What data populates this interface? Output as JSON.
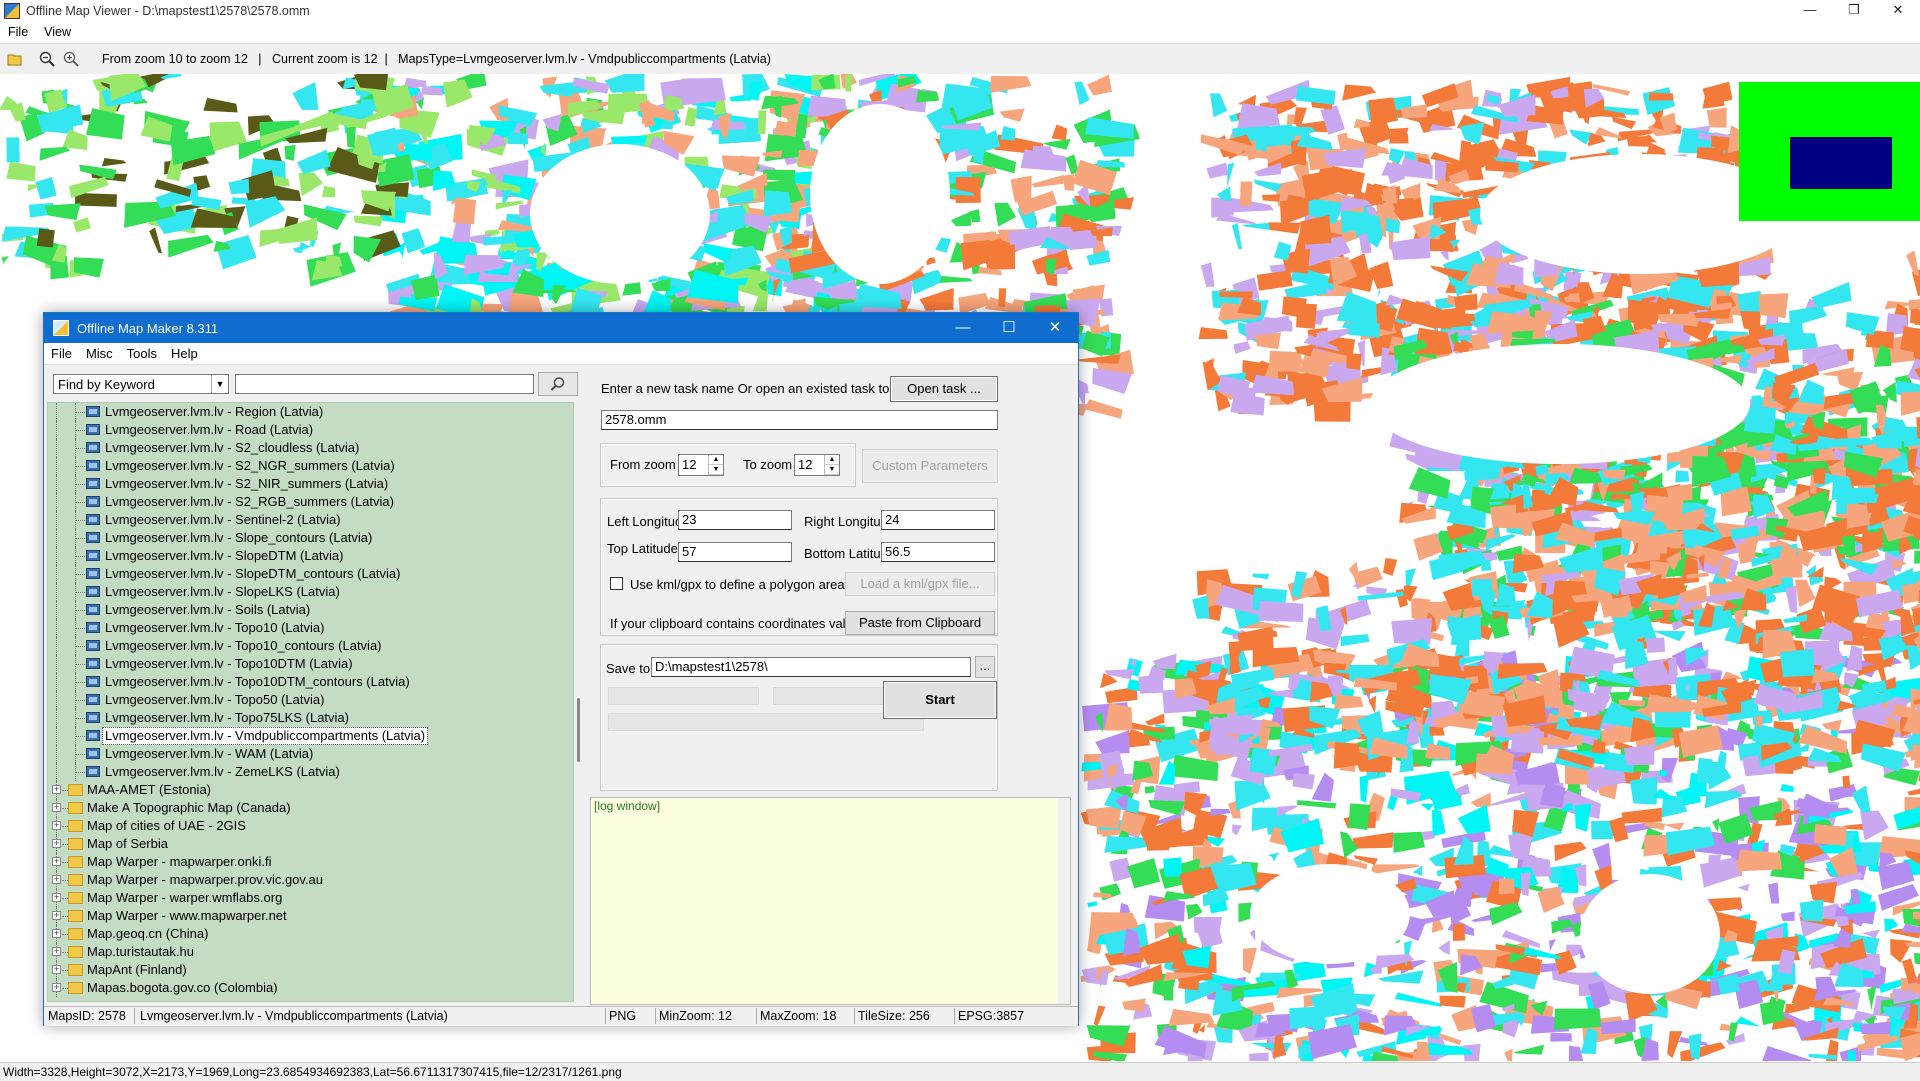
{
  "viewer": {
    "title": "Offline Map Viewer - D:\\mapstest1\\2578\\2578.omm",
    "menu": [
      "File",
      "View"
    ],
    "toolbar_info": "From zoom 10 to zoom 12   |   Current zoom is 12  |   MapsType=Lvmgeoserver.lvm.lv - Vmdpubliccompartments (Latvia)",
    "status": "Width=3328,Height=3072,X=2173,Y=1969,Long=23.6854934692383,Lat=56.6711317307415,file=12/2317/1261.png",
    "icons": [
      "open-folder-icon",
      "zoom-out-icon",
      "zoom-in-icon"
    ]
  },
  "map_colors": {
    "orange": "#f47a3a",
    "peach": "#f7a57c",
    "cyan": "#33e6f0",
    "aqua": "#00f5f5",
    "lavender": "#c9a8f0",
    "violet": "#b58cf0",
    "green": "#33dd55",
    "light_green": "#9ae86a",
    "olive": "#5a5a18",
    "minimap_bg": "#00ff00",
    "minimap_box": "#000080"
  },
  "maker": {
    "title": "Offline Map Maker 8.311",
    "menu": [
      "File",
      "Misc",
      "Tools",
      "Help"
    ],
    "search": {
      "mode": "Find by Keyword",
      "value": ""
    },
    "tree": {
      "children": [
        "Lvmgeoserver.lvm.lv - Region (Latvia)",
        "Lvmgeoserver.lvm.lv - Road (Latvia)",
        "Lvmgeoserver.lvm.lv - S2_cloudless (Latvia)",
        "Lvmgeoserver.lvm.lv - S2_NGR_summers (Latvia)",
        "Lvmgeoserver.lvm.lv - S2_NIR_summers (Latvia)",
        "Lvmgeoserver.lvm.lv - S2_RGB_summers (Latvia)",
        "Lvmgeoserver.lvm.lv - Sentinel-2 (Latvia)",
        "Lvmgeoserver.lvm.lv - Slope_contours (Latvia)",
        "Lvmgeoserver.lvm.lv - SlopeDTM (Latvia)",
        "Lvmgeoserver.lvm.lv - SlopeDTM_contours (Latvia)",
        "Lvmgeoserver.lvm.lv - SlopeLKS (Latvia)",
        "Lvmgeoserver.lvm.lv - Soils (Latvia)",
        "Lvmgeoserver.lvm.lv - Topo10 (Latvia)",
        "Lvmgeoserver.lvm.lv - Topo10_contours (Latvia)",
        "Lvmgeoserver.lvm.lv - Topo10DTM (Latvia)",
        "Lvmgeoserver.lvm.lv - Topo10DTM_contours (Latvia)",
        "Lvmgeoserver.lvm.lv - Topo50 (Latvia)",
        "Lvmgeoserver.lvm.lv - Topo75LKS (Latvia)",
        "Lvmgeoserver.lvm.lv - Vmdpubliccompartments (Latvia)",
        "Lvmgeoserver.lvm.lv - WAM (Latvia)",
        "Lvmgeoserver.lvm.lv - ZemeLKS (Latvia)"
      ],
      "selected_index": 18,
      "folders": [
        "MAA-AMET (Estonia)",
        "Make A Topographic Map (Canada)",
        "Map of cities of UAE - 2GIS",
        "Map of Serbia",
        "Map Warper - mapwarper.onki.fi",
        "Map Warper - mapwarper.prov.vic.gov.au",
        "Map Warper - warper.wmflabs.org",
        "Map Warper - www.mapwarper.net",
        "Map.geoq.cn (China)",
        "Map.turistautak.hu",
        "MapAnt (Finland)",
        "Mapas.bogota.gov.co (Colombia)"
      ]
    },
    "task": {
      "prompt": "Enter a new task name Or open an existed task to continue:",
      "open_button": "Open task ...",
      "name": "2578.omm"
    },
    "zoom": {
      "from_label": "From zoom",
      "from_value": "12",
      "to_label": "To zoom",
      "to_value": "12",
      "custom_button": "Custom Parameters"
    },
    "coords": {
      "left_label": "Left Longitude",
      "left_value": "23",
      "right_label": "Right Longitude",
      "right_value": "24",
      "top_label": "Top Latitude",
      "top_value": "57",
      "bottom_label": "Bottom Latitude",
      "bottom_value": "56.5"
    },
    "kml": {
      "checkbox_label": "Use kml/gpx to define a polygon area",
      "checked": false,
      "button": "Load a kml/gpx file..."
    },
    "clipboard": {
      "label": "If your clipboard contains coordinates values:",
      "button": "Paste from Clipboard"
    },
    "save": {
      "label": "Save to:",
      "path": "D:\\mapstest1\\2578\\",
      "browse": "..."
    },
    "start_button": "Start",
    "log": "[log window]",
    "status": {
      "maps_id": "MapsID: 2578",
      "maps_name": "Lvmgeoserver.lvm.lv - Vmdpubliccompartments (Latvia)",
      "format": "PNG",
      "min_zoom": "MinZoom: 12",
      "max_zoom": "MaxZoom: 18",
      "tile_size": "TileSize: 256",
      "epsg": "EPSG:3857"
    }
  }
}
